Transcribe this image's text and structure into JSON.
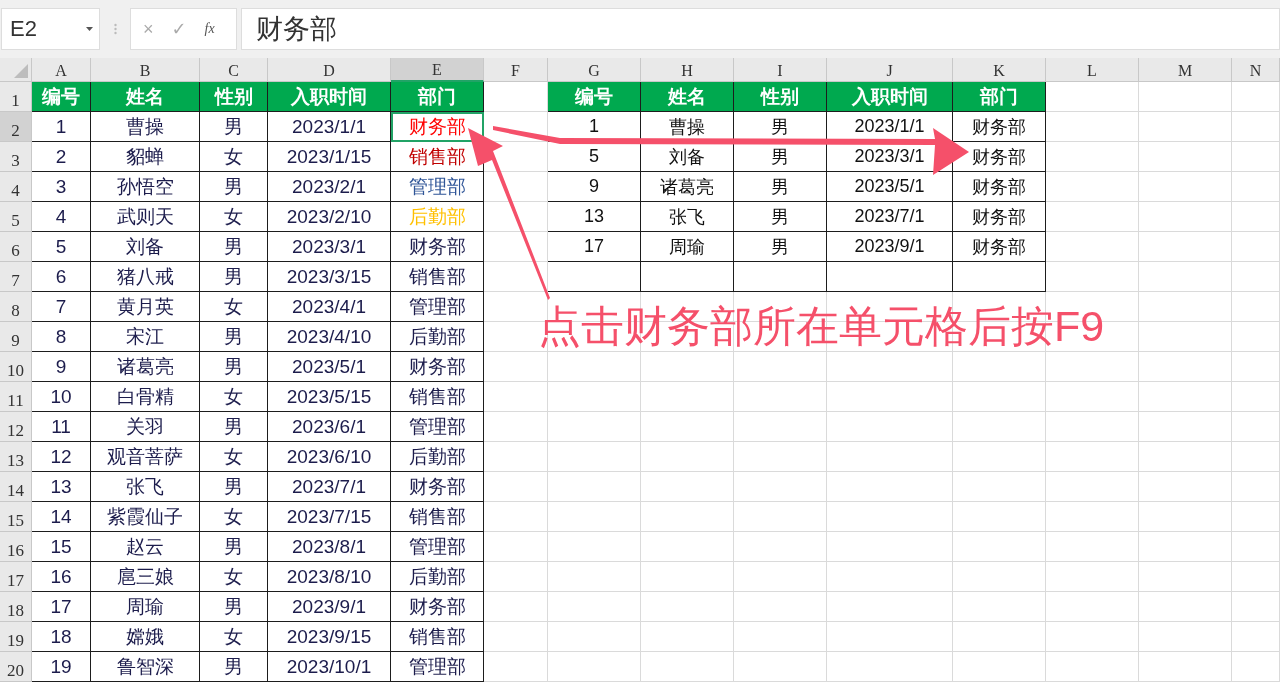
{
  "formula_bar": {
    "name_box": "E2",
    "cancel": "×",
    "confirm": "✓",
    "function": "fx",
    "content": "财务部"
  },
  "columns": [
    {
      "label": "A",
      "selected": false
    },
    {
      "label": "B",
      "selected": false
    },
    {
      "label": "C",
      "selected": false
    },
    {
      "label": "D",
      "selected": false
    },
    {
      "label": "E",
      "selected": true
    },
    {
      "label": "F",
      "selected": false
    },
    {
      "label": "G",
      "selected": false
    },
    {
      "label": "H",
      "selected": false
    },
    {
      "label": "I",
      "selected": false
    },
    {
      "label": "J",
      "selected": false
    },
    {
      "label": "K",
      "selected": false
    },
    {
      "label": "L",
      "selected": false
    },
    {
      "label": "M",
      "selected": false
    },
    {
      "label": "N",
      "selected": false
    }
  ],
  "row_headers": [
    {
      "label": "1",
      "selected": false
    },
    {
      "label": "2",
      "selected": true
    },
    {
      "label": "3",
      "selected": false
    },
    {
      "label": "4",
      "selected": false
    },
    {
      "label": "5",
      "selected": false
    },
    {
      "label": "6",
      "selected": false
    },
    {
      "label": "7",
      "selected": false
    },
    {
      "label": "8",
      "selected": false
    },
    {
      "label": "9",
      "selected": false
    },
    {
      "label": "10",
      "selected": false
    },
    {
      "label": "11",
      "selected": false
    },
    {
      "label": "12",
      "selected": false
    },
    {
      "label": "13",
      "selected": false
    },
    {
      "label": "14",
      "selected": false
    },
    {
      "label": "15",
      "selected": false
    },
    {
      "label": "16",
      "selected": false
    },
    {
      "label": "17",
      "selected": false
    },
    {
      "label": "18",
      "selected": false
    },
    {
      "label": "19",
      "selected": false
    },
    {
      "label": "20",
      "selected": false
    }
  ],
  "left_table": {
    "headers": [
      "编号",
      "姓名",
      "性别",
      "入职时间",
      "部门"
    ],
    "rows": [
      {
        "id": "1",
        "name": "曹操",
        "gender": "男",
        "date": "2023/1/1",
        "dept": "财务部",
        "color": "#ff0000",
        "selected": true
      },
      {
        "id": "2",
        "name": "貂蝉",
        "gender": "女",
        "date": "2023/1/15",
        "dept": "销售部",
        "color": "#c00000",
        "selected": false
      },
      {
        "id": "3",
        "name": "孙悟空",
        "gender": "男",
        "date": "2023/2/1",
        "dept": "管理部",
        "color": "#2f5597",
        "selected": false
      },
      {
        "id": "4",
        "name": "武则天",
        "gender": "女",
        "date": "2023/2/10",
        "dept": "后勤部",
        "color": "#ffc000",
        "selected": false
      },
      {
        "id": "5",
        "name": "刘备",
        "gender": "男",
        "date": "2023/3/1",
        "dept": "财务部",
        "color": "#1c1c4c",
        "selected": false
      },
      {
        "id": "6",
        "name": "猪八戒",
        "gender": "男",
        "date": "2023/3/15",
        "dept": "销售部",
        "color": "#1c1c4c",
        "selected": false
      },
      {
        "id": "7",
        "name": "黄月英",
        "gender": "女",
        "date": "2023/4/1",
        "dept": "管理部",
        "color": "#1c1c4c",
        "selected": false
      },
      {
        "id": "8",
        "name": "宋江",
        "gender": "男",
        "date": "2023/4/10",
        "dept": "后勤部",
        "color": "#1c1c4c",
        "selected": false
      },
      {
        "id": "9",
        "name": "诸葛亮",
        "gender": "男",
        "date": "2023/5/1",
        "dept": "财务部",
        "color": "#1c1c4c",
        "selected": false
      },
      {
        "id": "10",
        "name": "白骨精",
        "gender": "女",
        "date": "2023/5/15",
        "dept": "销售部",
        "color": "#1c1c4c",
        "selected": false
      },
      {
        "id": "11",
        "name": "关羽",
        "gender": "男",
        "date": "2023/6/1",
        "dept": "管理部",
        "color": "#1c1c4c",
        "selected": false
      },
      {
        "id": "12",
        "name": "观音菩萨",
        "gender": "女",
        "date": "2023/6/10",
        "dept": "后勤部",
        "color": "#1c1c4c",
        "selected": false
      },
      {
        "id": "13",
        "name": "张飞",
        "gender": "男",
        "date": "2023/7/1",
        "dept": "财务部",
        "color": "#1c1c4c",
        "selected": false
      },
      {
        "id": "14",
        "name": "紫霞仙子",
        "gender": "女",
        "date": "2023/7/15",
        "dept": "销售部",
        "color": "#1c1c4c",
        "selected": false
      },
      {
        "id": "15",
        "name": "赵云",
        "gender": "男",
        "date": "2023/8/1",
        "dept": "管理部",
        "color": "#1c1c4c",
        "selected": false
      },
      {
        "id": "16",
        "name": "扈三娘",
        "gender": "女",
        "date": "2023/8/10",
        "dept": "后勤部",
        "color": "#1c1c4c",
        "selected": false
      },
      {
        "id": "17",
        "name": "周瑜",
        "gender": "男",
        "date": "2023/9/1",
        "dept": "财务部",
        "color": "#1c1c4c",
        "selected": false
      },
      {
        "id": "18",
        "name": "嫦娥",
        "gender": "女",
        "date": "2023/9/15",
        "dept": "销售部",
        "color": "#1c1c4c",
        "selected": false
      },
      {
        "id": "19",
        "name": "鲁智深",
        "gender": "男",
        "date": "2023/10/1",
        "dept": "管理部",
        "color": "#1c1c4c",
        "selected": false
      }
    ]
  },
  "right_table": {
    "headers": [
      "编号",
      "姓名",
      "性别",
      "入职时间",
      "部门"
    ],
    "rows": [
      {
        "id": "1",
        "name": "曹操",
        "gender": "男",
        "date": "2023/1/1",
        "dept": "财务部"
      },
      {
        "id": "5",
        "name": "刘备",
        "gender": "男",
        "date": "2023/3/1",
        "dept": "财务部"
      },
      {
        "id": "9",
        "name": "诸葛亮",
        "gender": "男",
        "date": "2023/5/1",
        "dept": "财务部"
      },
      {
        "id": "13",
        "name": "张飞",
        "gender": "男",
        "date": "2023/7/1",
        "dept": "财务部"
      },
      {
        "id": "17",
        "name": "周瑜",
        "gender": "男",
        "date": "2023/9/1",
        "dept": "财务部"
      }
    ]
  },
  "annotation": "点击财务部所在单元格后按F9"
}
